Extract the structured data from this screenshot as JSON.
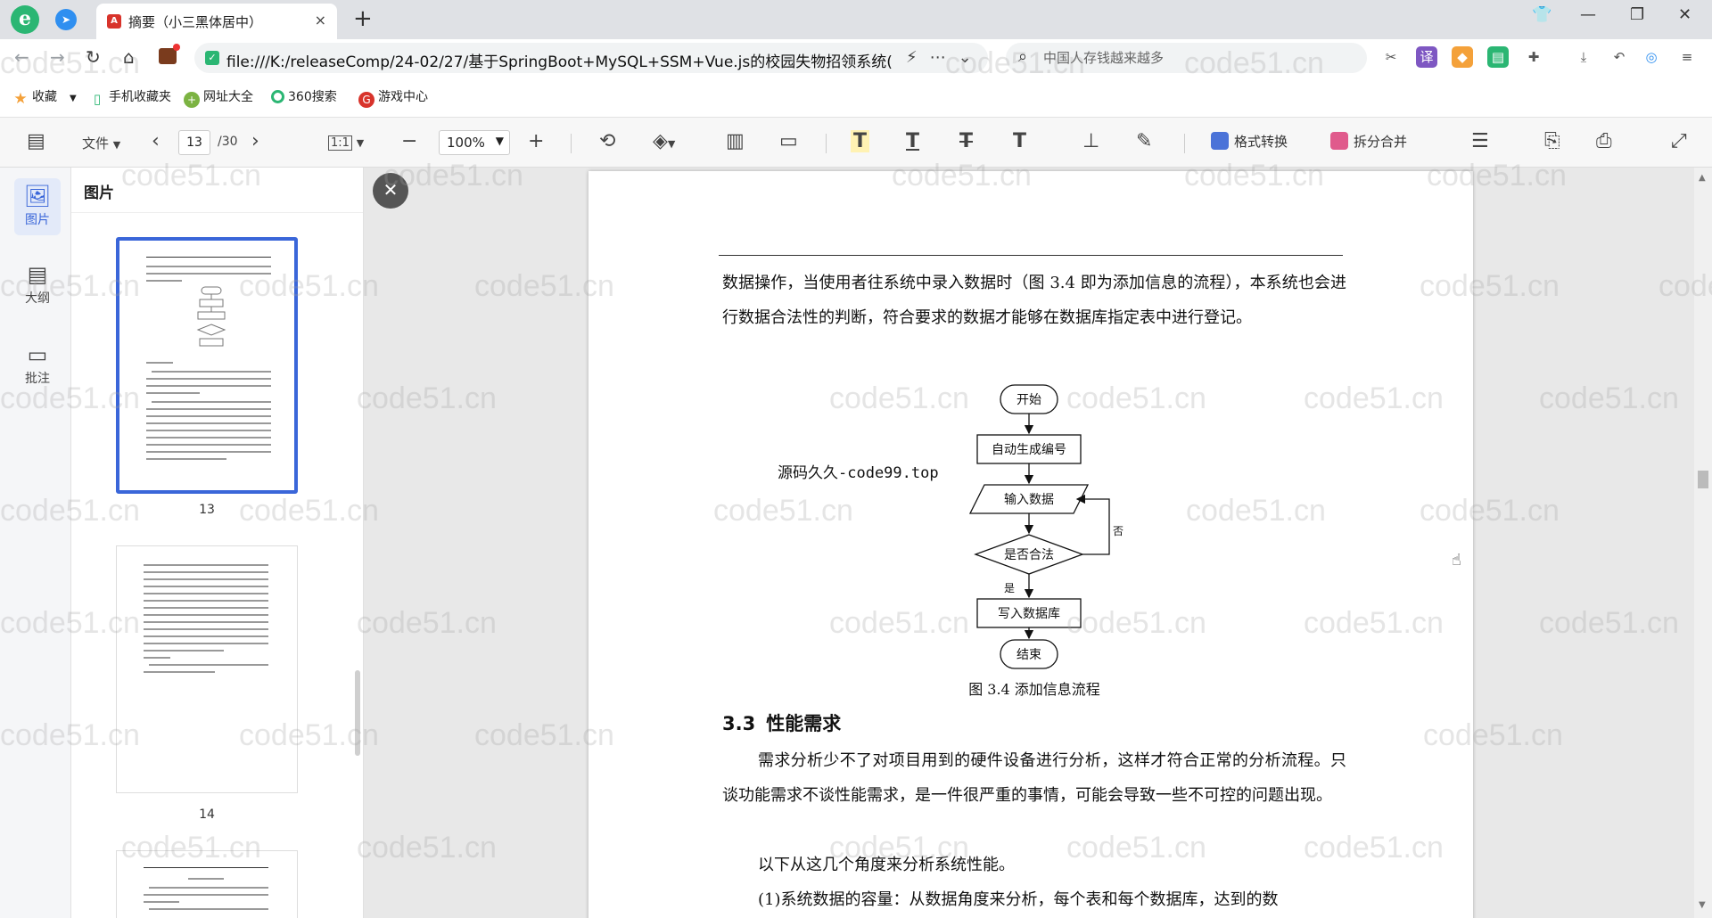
{
  "browser": {
    "brand_letter": "e",
    "tab_title": "摘要（小三黑体居中）",
    "tab_close": "×",
    "new_tab": "+",
    "url": "file:///K:/releaseComp/24-02/27/基于SpringBoot+MySQL+SSM+Vue.js的校园失物招领系统(",
    "search_placeholder": "中国人存钱越来越多",
    "bookmarks": [
      "收藏",
      "手机收藏夹",
      "网址大全",
      "360搜索",
      "游戏中心"
    ]
  },
  "pdf_toolbar": {
    "file_menu": "文件",
    "current_page": "13",
    "total_pages": "/30",
    "fit_label": "1:1",
    "zoom": "100%",
    "convert_label": "格式转换",
    "split_merge_label": "拆分合并"
  },
  "sidebar": {
    "items": [
      {
        "label": "图片",
        "icon": "image-icon"
      },
      {
        "label": "大纲",
        "icon": "outline-icon"
      },
      {
        "label": "批注",
        "icon": "comment-icon"
      }
    ]
  },
  "thumbnails": {
    "heading": "图片",
    "pages": [
      "13",
      "14"
    ]
  },
  "document": {
    "para1": "数据操作，当使用者往系统中录入数据时（图 3.4 即为添加信息的流程），本系统也会进行数据合法性的判断，符合要求的数据才能够在数据库指定表中进行登记。",
    "stamp": "源码久久-code99.top",
    "flowchart": {
      "start": "开始",
      "auto_id": "自动生成编号",
      "input": "输入数据",
      "check": "是否合法",
      "no": "否",
      "yes": "是",
      "write": "写入数据库",
      "end": "结束"
    },
    "caption": "图 3.4  添加信息流程",
    "section_number": "3.3",
    "section_title": "性能需求",
    "para2": "需求分析少不了对项目用到的硬件设备进行分析，这样才符合正常的分析流程。只谈功能需求不谈性能需求，是一件很严重的事情，可能会导致一些不可控的问题出现。",
    "para3": "以下从这几个角度来分析系统性能。",
    "para4": "(1)系统数据的容量：从数据角度来分析，每个表和每个数据库，达到的数"
  },
  "watermark": "code51.cn"
}
